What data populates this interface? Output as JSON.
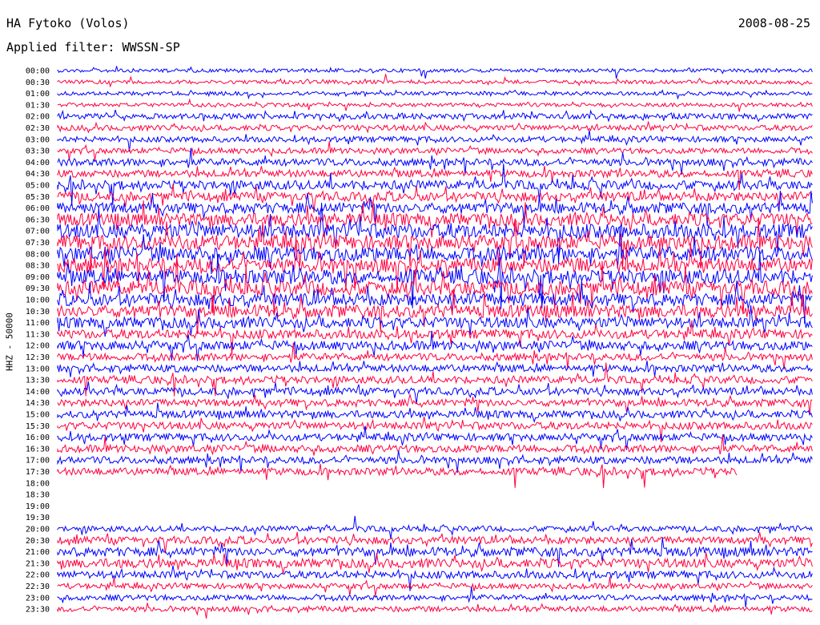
{
  "header": {
    "station": "HA Fytoko (Volos)",
    "date": "2008-08-25",
    "filter": "Applied filter: WWSSN-SP"
  },
  "chart_data": {
    "type": "line",
    "title": "HA Fytoko (Volos)",
    "ylabel": "HHZ - 50000",
    "xlabel": "",
    "tick_labels": [
      "00:00",
      "00:30",
      "01:00",
      "01:30",
      "02:00",
      "02:30",
      "03:00",
      "03:30",
      "04:00",
      "04:30",
      "05:00",
      "05:30",
      "06:00",
      "06:30",
      "07:00",
      "07:30",
      "08:00",
      "08:30",
      "09:00",
      "09:30",
      "10:00",
      "10:30",
      "11:00",
      "11:30",
      "12:00",
      "12:30",
      "13:00",
      "13:30",
      "14:00",
      "14:30",
      "15:00",
      "15:30",
      "16:00",
      "16:30",
      "17:00",
      "17:30",
      "18:00",
      "18:30",
      "19:00",
      "19:30",
      "20:00",
      "20:30",
      "21:00",
      "21:30",
      "22:00",
      "22:30",
      "23:00",
      "23:30"
    ],
    "colors": [
      "#0000ff",
      "#ff0040"
    ],
    "gap": {
      "start": "18:00",
      "end": "20:00"
    },
    "trace_end_fraction": {
      "17:30": 0.9
    },
    "activity": [
      1,
      1,
      1,
      1,
      2,
      2,
      2,
      2,
      3,
      3,
      4,
      4,
      5,
      6,
      7,
      7,
      7,
      7,
      7,
      7,
      6,
      6,
      5,
      4,
      4,
      3,
      3,
      3,
      3,
      3,
      3,
      3,
      3,
      3,
      3,
      3,
      0,
      0,
      0,
      0,
      2,
      3,
      4,
      4,
      3,
      2,
      2,
      2
    ]
  }
}
